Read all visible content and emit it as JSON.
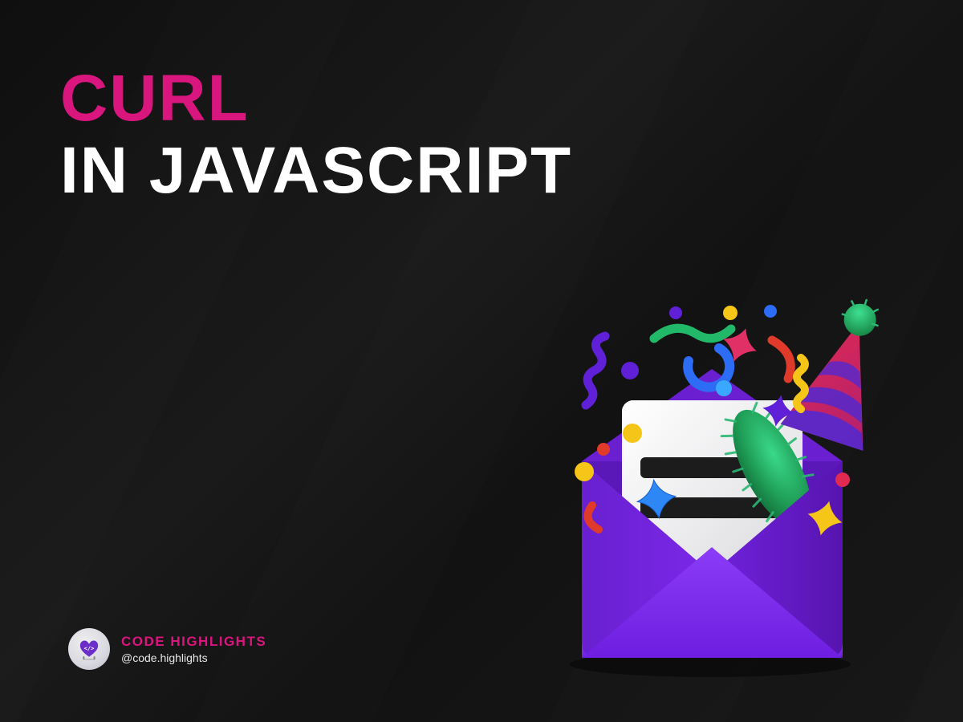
{
  "title": {
    "line1": "CURL",
    "line2": "IN JAVASCRIPT"
  },
  "brand": {
    "name": "CODE HIGHLIGHTS",
    "handle": "@code.highlights"
  },
  "colors": {
    "accent_magenta": "#d9157e",
    "bg_dark": "#131313",
    "text_white": "#ffffff",
    "text_light": "#e6e6e6",
    "envelope_purple": "#7c28e8",
    "envelope_purple_dark": "#5a18b8",
    "envelope_purple_light": "#9955ff",
    "paper_white": "#eeeeee",
    "paper_line": "#1c1c1c",
    "confetti_yellow": "#f5c518",
    "confetti_blue": "#2d6cf5",
    "confetti_cyan": "#3aa8ff",
    "confetti_red": "#e03a2a",
    "confetti_green": "#22b86a",
    "confetti_green_fuzzy": "#1f9e57",
    "confetti_purple": "#6020d8",
    "hat_red": "#e02a52",
    "hat_purple": "#5a28c8",
    "hat_pom": "#1aa055"
  },
  "illustration": {
    "name": "envelope-confetti-celebration-icon"
  }
}
